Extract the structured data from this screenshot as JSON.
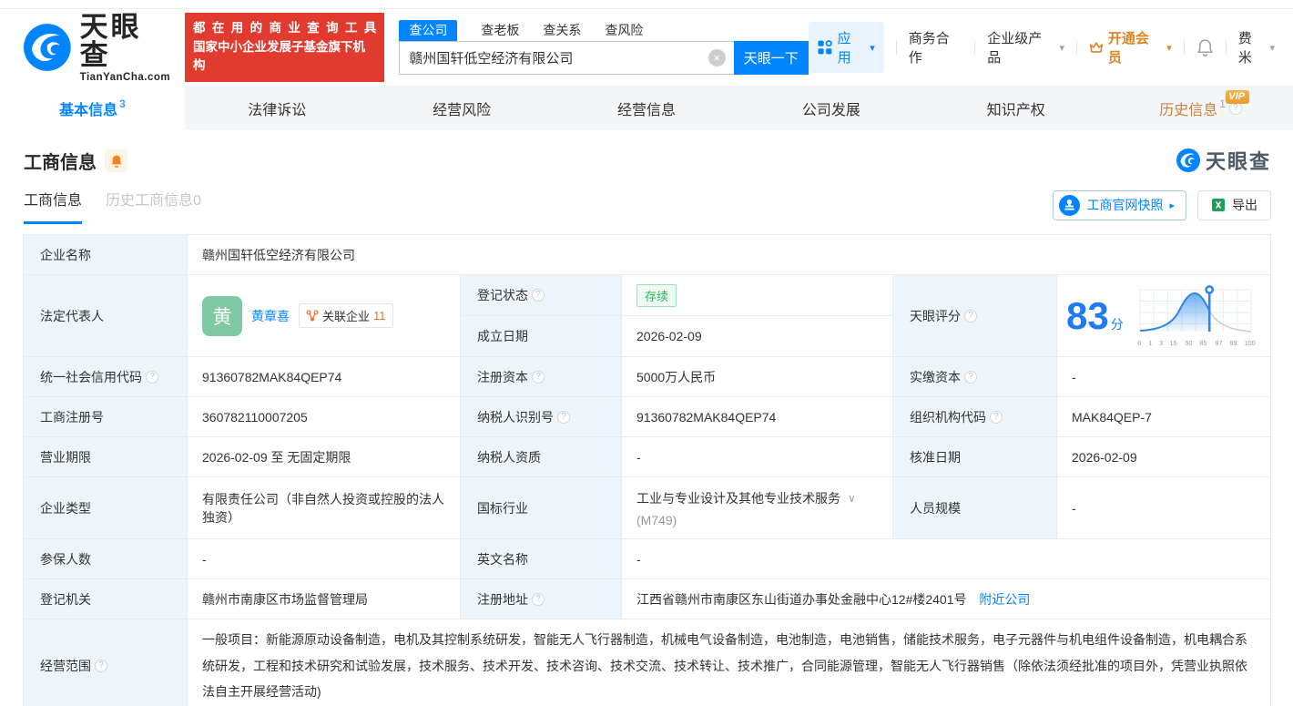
{
  "brand": {
    "name": "天眼查",
    "domain": "TianYanCha.com",
    "slogan_line1": "都在用的商业查询工具",
    "slogan_line2": "国家中小企业发展子基金旗下机构",
    "watermark": "天眼查"
  },
  "icons": {
    "question": "?",
    "caret_down": "▾",
    "chevron_down": "∨",
    "arrow_right": "▸",
    "clear": "×"
  },
  "colors": {
    "brand_blue": "#0084ff",
    "slogan_red": "#e13b30",
    "vip_orange": "#ee9a2d",
    "status_green": "#2ab35f"
  },
  "search": {
    "tabs": [
      {
        "label": "查公司",
        "active": true
      },
      {
        "label": "查老板",
        "active": false
      },
      {
        "label": "查关系",
        "active": false
      },
      {
        "label": "查风险",
        "active": false
      }
    ],
    "value": "赣州国轩低空经济有限公司",
    "button": "天眼一下"
  },
  "topnav": {
    "apps": "应用",
    "coop": "商务合作",
    "enterprise": "企业级产品",
    "vip": "开通会员",
    "user": "费米"
  },
  "nav_tabs": [
    {
      "label": "基本信息",
      "count": "3",
      "active": true
    },
    {
      "label": "法律诉讼"
    },
    {
      "label": "经营风险"
    },
    {
      "label": "经营信息"
    },
    {
      "label": "公司发展"
    },
    {
      "label": "知识产权"
    },
    {
      "label": "历史信息",
      "count": "1",
      "vip": "VIP"
    }
  ],
  "section": {
    "title": "工商信息",
    "subtab_active": "工商信息",
    "subtab_history": "历史工商信息",
    "subtab_history_count": "0",
    "snapshot_button": "工商官网快照",
    "export_button": "导出"
  },
  "score": {
    "label": "天眼评分",
    "value": "83",
    "unit": "分",
    "axis": [
      "0",
      "1",
      "3",
      "15",
      "50",
      "85",
      "97",
      "99",
      "100"
    ]
  },
  "fields": {
    "company_name": {
      "label": "企业名称",
      "value": "赣州国轩低空经济有限公司"
    },
    "legal_rep": {
      "label": "法定代表人",
      "avatar": "黄",
      "name": "黄章喜",
      "related_label": "关联企业",
      "related_count": "11"
    },
    "reg_status": {
      "label": "登记状态",
      "value": "存续"
    },
    "establish_date": {
      "label": "成立日期",
      "value": "2026-02-09"
    },
    "credit_code": {
      "label": "统一社会信用代码",
      "value": "91360782MAK84QEP74"
    },
    "reg_capital": {
      "label": "注册资本",
      "value": "5000万人民币"
    },
    "paid_capital": {
      "label": "实缴资本",
      "value": "-"
    },
    "reg_number": {
      "label": "工商注册号",
      "value": "360782110007205"
    },
    "taxpayer_id": {
      "label": "纳税人识别号",
      "value": "91360782MAK84QEP74"
    },
    "org_code": {
      "label": "组织机构代码",
      "value": "MAK84QEP-7"
    },
    "business_term": {
      "label": "营业期限",
      "value": "2026-02-09 至 无固定期限"
    },
    "taxpayer_quality": {
      "label": "纳税人资质",
      "value": "-"
    },
    "approve_date": {
      "label": "核准日期",
      "value": "2026-02-09"
    },
    "company_type": {
      "label": "企业类型",
      "value": "有限责任公司（非自然人投资或控股的法人独资）"
    },
    "industry": {
      "label": "国标行业",
      "value": "工业与专业设计及其他专业技术服务",
      "code": "(M749)"
    },
    "staff_size": {
      "label": "人员规模",
      "value": "-"
    },
    "insured_count": {
      "label": "参保人数",
      "value": "-"
    },
    "english_name": {
      "label": "英文名称",
      "value": "-"
    },
    "reg_authority": {
      "label": "登记机关",
      "value": "赣州市南康区市场监督管理局"
    },
    "reg_address": {
      "label": "注册地址",
      "value": "江西省赣州市南康区东山街道办事处金融中心12#楼2401号",
      "link": "附近公司"
    },
    "business_scope": {
      "label": "经营范围",
      "value": "一般项目：新能源原动设备制造，电机及其控制系统研发，智能无人飞行器制造，机械电气设备制造，电池制造，电池销售，储能技术服务，电子元器件与机电组件设备制造，机电耦合系统研发，工程和技术研究和试验发展，技术服务、技术开发、技术咨询、技术交流、技术转让、技术推广，合同能源管理，智能无人飞行器销售（除依法须经批准的项目外，凭营业执照依法自主开展经营活动)"
    }
  }
}
